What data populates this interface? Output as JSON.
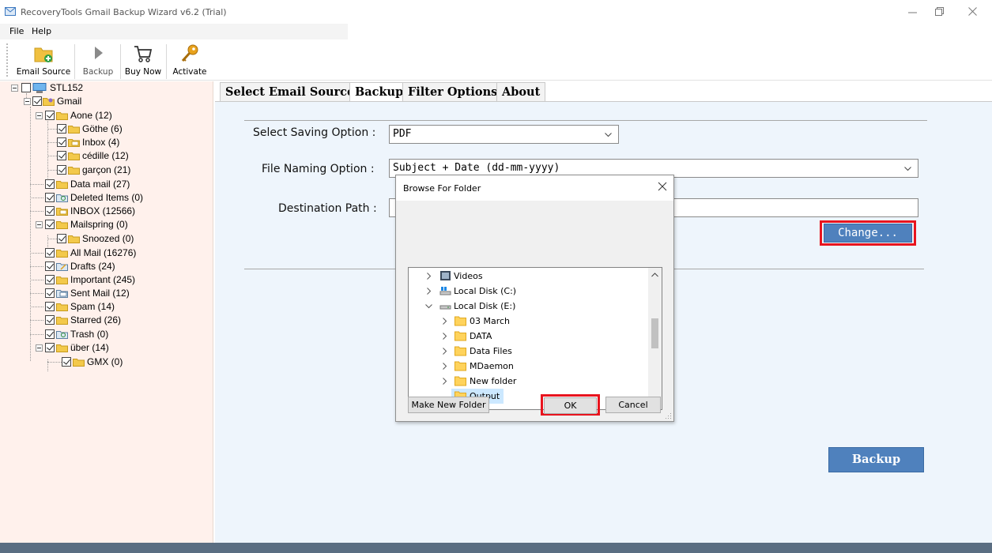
{
  "window": {
    "title": "RecoveryTools Gmail Backup Wizard v6.2 (Trial)"
  },
  "menu": {
    "items": [
      "File",
      "Help"
    ]
  },
  "toolbar": {
    "email_source": "Email Source",
    "backup": "Backup",
    "buy_now": "Buy Now",
    "activate": "Activate"
  },
  "tree": {
    "root": "STL152",
    "account": "Gmail",
    "nodes": [
      "Aone (12)",
      "Göthe (6)",
      "Inbox (4)",
      "cédille (12)",
      "garçon (21)",
      "Data mail (27)",
      "Deleted Items (0)",
      "INBOX (12566)",
      "Mailspring (0)",
      "Snoozed (0)",
      "All Mail (16276)",
      "Drafts (24)",
      "Important (245)",
      "Sent Mail (12)",
      "Spam (14)",
      "Starred (26)",
      "Trash (0)",
      "über (14)",
      "GMX (0)"
    ]
  },
  "tabs": [
    "Select Email Source",
    "Backup",
    "Filter Options",
    "About"
  ],
  "active_tab": "Backup",
  "form": {
    "saving_label": "Select Saving Option :",
    "saving_value": "PDF",
    "naming_label": "File Naming Option :",
    "naming_value": "Subject + Date (dd-mm-yyyy)",
    "dest_label": "Destination Path :",
    "dest_value": "",
    "change_button": "Change...",
    "backup_button": "Backup"
  },
  "dialog": {
    "title": "Browse For Folder",
    "folders": [
      "Videos",
      "Local Disk (C:)",
      "Local Disk (E:)",
      "03 March",
      "DATA",
      "Data Files",
      "MDaemon",
      "New folder",
      "Output"
    ],
    "selected": "Output",
    "make_new_folder": "Make New Folder",
    "ok": "OK",
    "cancel": "Cancel"
  },
  "colors": {
    "accent_button": "#4f81bd",
    "highlight": "#e8141e",
    "tree_background": "#fff1ec",
    "content_background": "#eef5fc",
    "statusbar": "#5a6e82"
  }
}
